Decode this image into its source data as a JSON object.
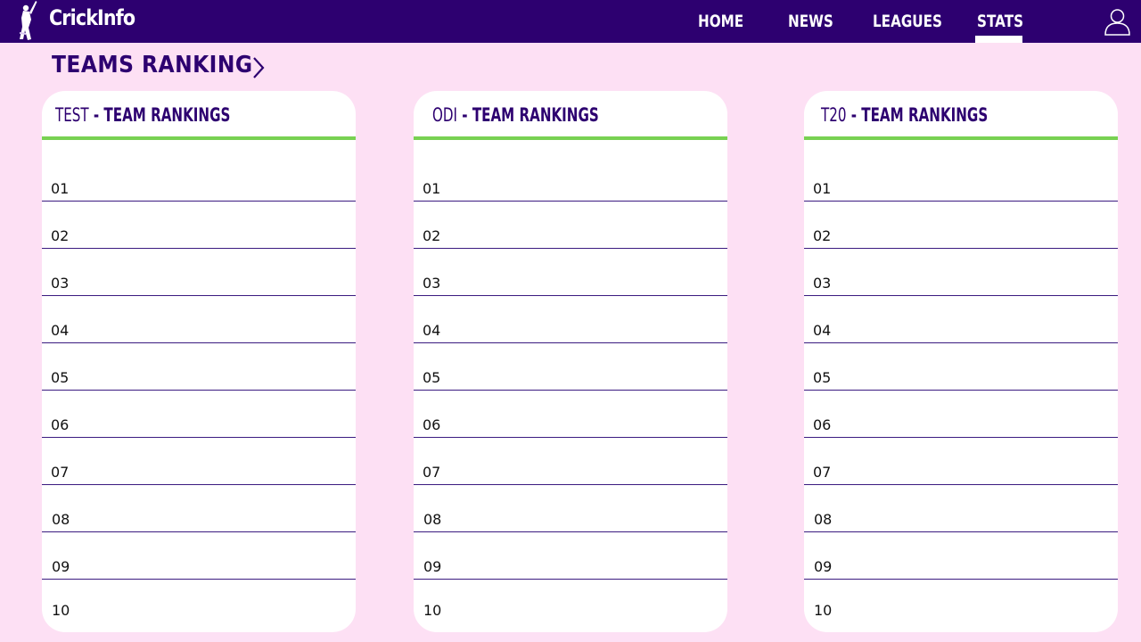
{
  "header": {
    "brand": "CrickInfo",
    "nav": [
      {
        "label": "HOME"
      },
      {
        "label": "NEWS"
      },
      {
        "label": "LEAGUES"
      },
      {
        "label": "STATS",
        "active": true
      }
    ]
  },
  "section": {
    "title": "TEAMS RANKING"
  },
  "cards": [
    {
      "format": "TEST",
      "title_rest": " - TEAM RANKINGS",
      "ranks": [
        "01",
        "02",
        "03",
        "04",
        "05",
        "06",
        "07",
        "08",
        "09",
        "10"
      ]
    },
    {
      "format": "ODI",
      "title_rest": " - TEAM RANKINGS",
      "ranks": [
        "01",
        "02",
        "03",
        "04",
        "05",
        "06",
        "07",
        "08",
        "09",
        "10"
      ]
    },
    {
      "format": "T20",
      "title_rest": " - TEAM RANKINGS",
      "ranks": [
        "01",
        "02",
        "03",
        "04",
        "05",
        "06",
        "07",
        "08",
        "09",
        "10"
      ]
    }
  ],
  "colors": {
    "navbar": "#2d0070",
    "page_bg": "#fde0f4",
    "accent_green": "#78d152",
    "title_purple": "#2d0070"
  },
  "icons": {
    "logo": "batsman-logo-icon",
    "user": "user-profile-icon",
    "chevron": "chevron-right-icon"
  }
}
